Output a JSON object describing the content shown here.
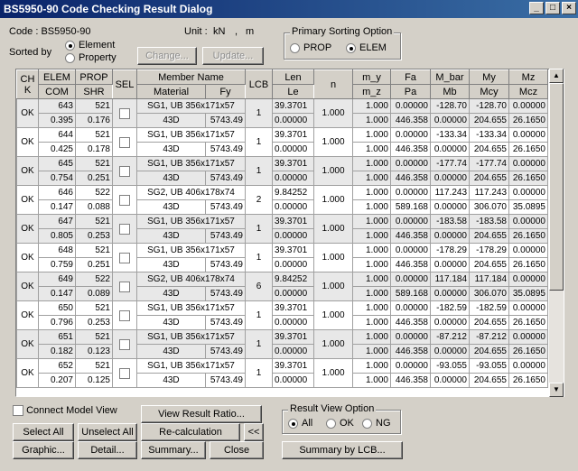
{
  "window": {
    "title": "BS5950-90 Code Checking Result Dialog"
  },
  "info": {
    "code_label": "Code : BS5950-90",
    "unit_label": "Unit :",
    "unit_force": "kN",
    "unit_sep": ",",
    "unit_length": "m",
    "sorted_by_label": "Sorted by"
  },
  "sort": {
    "element": "Element",
    "property": "Property",
    "selected": "Element"
  },
  "buttons": {
    "change": "Change...",
    "update": "Update...",
    "view_result_ratio": "View Result Ratio...",
    "select_all": "Select All",
    "unselect_all": "Unselect All",
    "recalculation": "Re-calculation",
    "collapse": "<<",
    "graphic": "Graphic...",
    "detail": "Detail...",
    "summary": "Summary...",
    "close": "Close",
    "summary_by_lcb": "Summary by LCB..."
  },
  "primary_sort": {
    "title": "Primary Sorting Option",
    "prop": "PROP",
    "elem": "ELEM",
    "selected": "ELEM"
  },
  "connect_model_view": "Connect Model View",
  "result_view": {
    "title": "Result View Option",
    "all": "All",
    "ok": "OK",
    "ng": "NG",
    "selected": "All"
  },
  "table": {
    "headers": {
      "chk": "CH K",
      "elem": "ELEM",
      "com": "COM",
      "prop": "PROP",
      "shr": "SHR",
      "sel": "SEL",
      "member_name": "Member Name",
      "material": "Material",
      "fy": "Fy",
      "lcb": "LCB",
      "len": "Len",
      "le": "Le",
      "n": "n",
      "m_y": "m_y",
      "m_z": "m_z",
      "fa": "Fa",
      "pa": "Pa",
      "m_bar": "M_bar",
      "mb": "Mb",
      "my": "My",
      "mcy": "Mcy",
      "mz": "Mz",
      "mcz": "Mcz"
    },
    "rows": [
      {
        "chk": "OK",
        "elem": "643",
        "com": "0.395",
        "prop": "521",
        "shr": "0.176",
        "member": "SG1, UB 356x171x57",
        "material": "43D",
        "fy": "5743.49",
        "lcb": "1",
        "len": "39.3701",
        "le": "0.00000",
        "n": "1.000",
        "m_y": "1.000",
        "m_z": "1.000",
        "fa": "0.00000",
        "pa": "446.358",
        "m_bar": "-128.70",
        "mb": "0.00000",
        "my": "-128.70",
        "mcy": "204.655",
        "mz": "0.00000",
        "mcz": "26.1650",
        "gray": true
      },
      {
        "chk": "OK",
        "elem": "644",
        "com": "0.425",
        "prop": "521",
        "shr": "0.178",
        "member": "SG1, UB 356x171x57",
        "material": "43D",
        "fy": "5743.49",
        "lcb": "1",
        "len": "39.3701",
        "le": "0.00000",
        "n": "1.000",
        "m_y": "1.000",
        "m_z": "1.000",
        "fa": "0.00000",
        "pa": "446.358",
        "m_bar": "-133.34",
        "mb": "0.00000",
        "my": "-133.34",
        "mcy": "204.655",
        "mz": "0.00000",
        "mcz": "26.1650",
        "gray": false
      },
      {
        "chk": "OK",
        "elem": "645",
        "com": "0.754",
        "prop": "521",
        "shr": "0.251",
        "member": "SG1, UB 356x171x57",
        "material": "43D",
        "fy": "5743.49",
        "lcb": "1",
        "len": "39.3701",
        "le": "0.00000",
        "n": "1.000",
        "m_y": "1.000",
        "m_z": "1.000",
        "fa": "0.00000",
        "pa": "446.358",
        "m_bar": "-177.74",
        "mb": "0.00000",
        "my": "-177.74",
        "mcy": "204.655",
        "mz": "0.00000",
        "mcz": "26.1650",
        "gray": true
      },
      {
        "chk": "OK",
        "elem": "646",
        "com": "0.147",
        "prop": "522",
        "shr": "0.088",
        "member": "SG2, UB 406x178x74",
        "material": "43D",
        "fy": "5743.49",
        "lcb": "2",
        "len": "9.84252",
        "le": "0.00000",
        "n": "1.000",
        "m_y": "1.000",
        "m_z": "1.000",
        "fa": "0.00000",
        "pa": "589.168",
        "m_bar": "117.243",
        "mb": "0.00000",
        "my": "117.243",
        "mcy": "306.070",
        "mz": "0.00000",
        "mcz": "35.0895",
        "gray": false
      },
      {
        "chk": "OK",
        "elem": "647",
        "com": "0.805",
        "prop": "521",
        "shr": "0.253",
        "member": "SG1, UB 356x171x57",
        "material": "43D",
        "fy": "5743.49",
        "lcb": "1",
        "len": "39.3701",
        "le": "0.00000",
        "n": "1.000",
        "m_y": "1.000",
        "m_z": "1.000",
        "fa": "0.00000",
        "pa": "446.358",
        "m_bar": "-183.58",
        "mb": "0.00000",
        "my": "-183.58",
        "mcy": "204.655",
        "mz": "0.00000",
        "mcz": "26.1650",
        "gray": true
      },
      {
        "chk": "OK",
        "elem": "648",
        "com": "0.759",
        "prop": "521",
        "shr": "0.251",
        "member": "SG1, UB 356x171x57",
        "material": "43D",
        "fy": "5743.49",
        "lcb": "1",
        "len": "39.3701",
        "le": "0.00000",
        "n": "1.000",
        "m_y": "1.000",
        "m_z": "1.000",
        "fa": "0.00000",
        "pa": "446.358",
        "m_bar": "-178.29",
        "mb": "0.00000",
        "my": "-178.29",
        "mcy": "204.655",
        "mz": "0.00000",
        "mcz": "26.1650",
        "gray": false
      },
      {
        "chk": "OK",
        "elem": "649",
        "com": "0.147",
        "prop": "522",
        "shr": "0.089",
        "member": "SG2, UB 406x178x74",
        "material": "43D",
        "fy": "5743.49",
        "lcb": "6",
        "len": "9.84252",
        "le": "0.00000",
        "n": "1.000",
        "m_y": "1.000",
        "m_z": "1.000",
        "fa": "0.00000",
        "pa": "589.168",
        "m_bar": "117.184",
        "mb": "0.00000",
        "my": "117.184",
        "mcy": "306.070",
        "mz": "0.00000",
        "mcz": "35.0895",
        "gray": true
      },
      {
        "chk": "OK",
        "elem": "650",
        "com": "0.796",
        "prop": "521",
        "shr": "0.253",
        "member": "SG1, UB 356x171x57",
        "material": "43D",
        "fy": "5743.49",
        "lcb": "1",
        "len": "39.3701",
        "le": "0.00000",
        "n": "1.000",
        "m_y": "1.000",
        "m_z": "1.000",
        "fa": "0.00000",
        "pa": "446.358",
        "m_bar": "-182.59",
        "mb": "0.00000",
        "my": "-182.59",
        "mcy": "204.655",
        "mz": "0.00000",
        "mcz": "26.1650",
        "gray": false
      },
      {
        "chk": "OK",
        "elem": "651",
        "com": "0.182",
        "prop": "521",
        "shr": "0.123",
        "member": "SG1, UB 356x171x57",
        "material": "43D",
        "fy": "5743.49",
        "lcb": "1",
        "len": "39.3701",
        "le": "0.00000",
        "n": "1.000",
        "m_y": "1.000",
        "m_z": "1.000",
        "fa": "0.00000",
        "pa": "446.358",
        "m_bar": "-87.212",
        "mb": "0.00000",
        "my": "-87.212",
        "mcy": "204.655",
        "mz": "0.00000",
        "mcz": "26.1650",
        "gray": true
      },
      {
        "chk": "OK",
        "elem": "652",
        "com": "0.207",
        "prop": "521",
        "shr": "0.125",
        "member": "SG1, UB 356x171x57",
        "material": "43D",
        "fy": "5743.49",
        "lcb": "1",
        "len": "39.3701",
        "le": "0.00000",
        "n": "1.000",
        "m_y": "1.000",
        "m_z": "1.000",
        "fa": "0.00000",
        "pa": "446.358",
        "m_bar": "-93.055",
        "mb": "0.00000",
        "my": "-93.055",
        "mcy": "204.655",
        "mz": "0.00000",
        "mcz": "26.1650",
        "gray": false
      }
    ]
  }
}
